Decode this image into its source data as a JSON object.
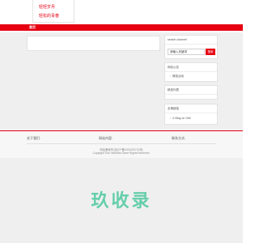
{
  "dropdown": {
    "items": [
      "轻轻岁月",
      "轻松的青春"
    ]
  },
  "nav": {
    "active_label": "首页"
  },
  "sidebar": {
    "search": {
      "title": "search channel",
      "placeholder": "请输入关键词",
      "button_label": "搜索"
    },
    "notice": {
      "title": "网站公告",
      "items": [
        "微信活动"
      ]
    },
    "recent": {
      "title": "精选列表"
    },
    "links": {
      "title": "友情链接",
      "items": [
        "Z-Blog on Gith"
      ]
    }
  },
  "footer": {
    "col_about": "关于我们:",
    "col_site": "网站内容:",
    "col_contact": "联系方式:",
    "icp": "网站备案号:[京ICP备2021000712号]",
    "copyright": "Copyright Your WebSite.Some Rights Reserved."
  },
  "watermark": "玖收录",
  "colors": {
    "accent": "#e60012",
    "watermark": "#4ec9a0",
    "background": "#efefef"
  }
}
